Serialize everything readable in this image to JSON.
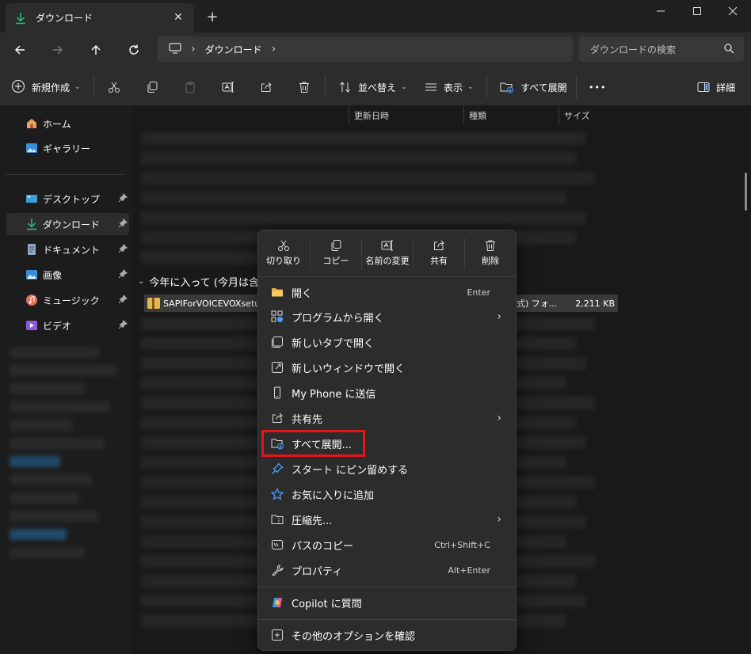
{
  "window": {
    "tab_label": "ダウンロード",
    "tab_close": "✕",
    "new_tab": "+",
    "buttons": [
      "minimize",
      "maximize",
      "close"
    ]
  },
  "nav": {
    "breadcrumb": "ダウンロード",
    "search_placeholder": "ダウンロードの検索"
  },
  "commandbar": {
    "new": "新規作成",
    "sort": "並べ替え",
    "view": "表示",
    "extract_all": "すべて展開",
    "more": "•••",
    "details": "詳細"
  },
  "sidebar": {
    "items": [
      {
        "label": "ホーム",
        "icon": "home-icon"
      },
      {
        "label": "ギャラリー",
        "icon": "gallery-icon"
      },
      {
        "label": "デスクトップ",
        "icon": "desktop-icon"
      },
      {
        "label": "ダウンロード",
        "icon": "download-icon"
      },
      {
        "label": "ドキュメント",
        "icon": "document-icon"
      },
      {
        "label": "画像",
        "icon": "image-icon"
      },
      {
        "label": "ミュージック",
        "icon": "music-icon"
      },
      {
        "label": "ビデオ",
        "icon": "video-icon"
      }
    ]
  },
  "list": {
    "columns": [
      "更新日時",
      "種類",
      "サイズ"
    ],
    "group_label": "今年に入って (今月は含",
    "selected_file": {
      "name": "SAPIForVOICEVOXsetu",
      "type": "式) フォ...",
      "size": "2,211 KB"
    }
  },
  "context_menu": {
    "quick_actions": [
      {
        "label": "切り取り",
        "icon": "cut-icon"
      },
      {
        "label": "コピー",
        "icon": "copy-icon"
      },
      {
        "label": "名前の変更",
        "icon": "rename-icon"
      },
      {
        "label": "共有",
        "icon": "share-icon"
      },
      {
        "label": "削除",
        "icon": "delete-icon"
      }
    ],
    "items": [
      {
        "label": "開く",
        "shortcut": "Enter"
      },
      {
        "label": "プログラムから開く",
        "arrow": "›"
      },
      {
        "label": "新しいタブで開く"
      },
      {
        "label": "新しいウィンドウで開く"
      },
      {
        "label": "My Phone に送信"
      },
      {
        "label": "共有先",
        "arrow": "›"
      },
      {
        "label": "すべて展開..."
      },
      {
        "label": "スタート にピン留めする"
      },
      {
        "label": "お気に入りに追加"
      },
      {
        "label": "圧縮先...",
        "arrow": "›"
      },
      {
        "label": "パスのコピー",
        "shortcut": "Ctrl+Shift+C"
      },
      {
        "label": "プロパティ",
        "shortcut": "Alt+Enter"
      },
      {
        "label": "Copilot に質問"
      },
      {
        "label": "その他のオプションを確認"
      }
    ]
  },
  "colors": {
    "accent_download": "#2fb47a",
    "highlight_box": "#e0161a",
    "menu_bg": "#2c2c2c"
  }
}
